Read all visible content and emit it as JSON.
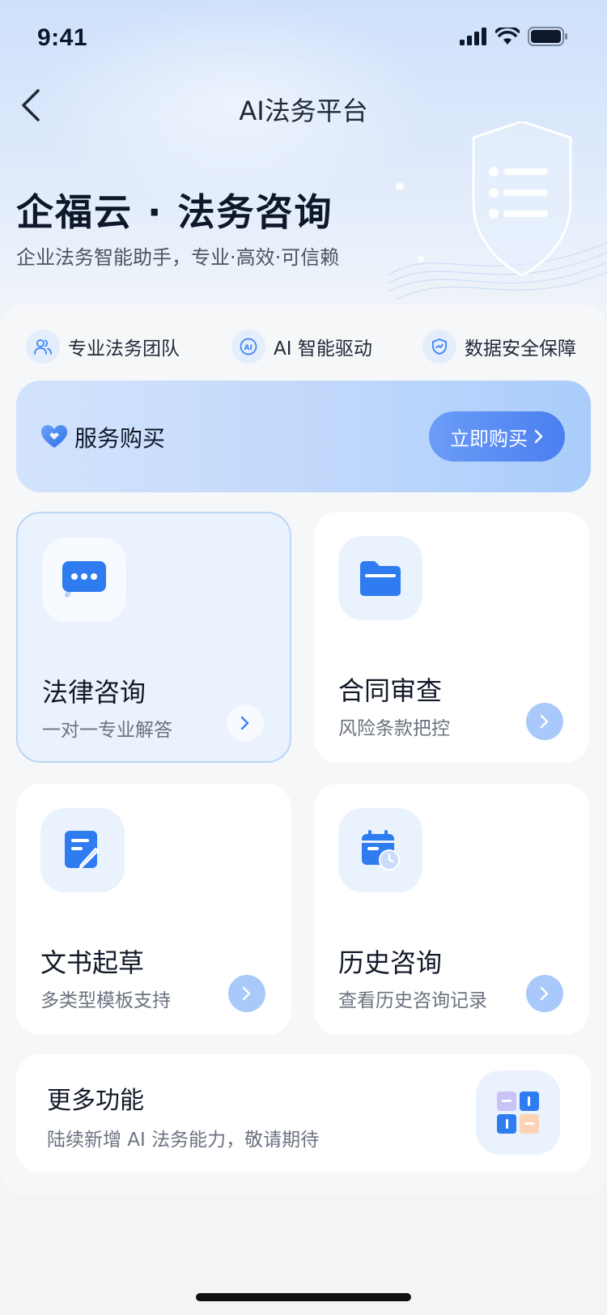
{
  "status_bar": {
    "time": "9:41"
  },
  "nav": {
    "title": "AI法务平台"
  },
  "hero": {
    "title": "企福云 · 法务咨询",
    "subtitle": "企业法务智能助手，专业·高效·可信赖"
  },
  "features": [
    {
      "label": "专业法务团队",
      "icon": "team-icon"
    },
    {
      "label": "AI 智能驱动",
      "icon": "ai-icon"
    },
    {
      "label": "数据安全保障",
      "icon": "shield-check-icon"
    }
  ],
  "purchase": {
    "title": "服务购买",
    "button_label": "立即购买"
  },
  "cards": [
    {
      "title": "法律咨询",
      "subtitle": "一对一专业解答",
      "icon": "chat-bubble-icon"
    },
    {
      "title": "合同审查",
      "subtitle": "风险条款把控",
      "icon": "folder-icon"
    },
    {
      "title": "文书起草",
      "subtitle": "多类型模板支持",
      "icon": "document-edit-icon"
    },
    {
      "title": "历史咨询",
      "subtitle": "查看历史咨询记录",
      "icon": "calendar-clock-icon"
    }
  ],
  "more": {
    "title": "更多功能",
    "subtitle": "陆续新增 AI 法务能力，敬请期待",
    "icon": "puzzle-icon"
  },
  "colors": {
    "accent": "#2f7bf0",
    "accent_light": "#a8c9fa",
    "card_bg": "#ffffff"
  }
}
